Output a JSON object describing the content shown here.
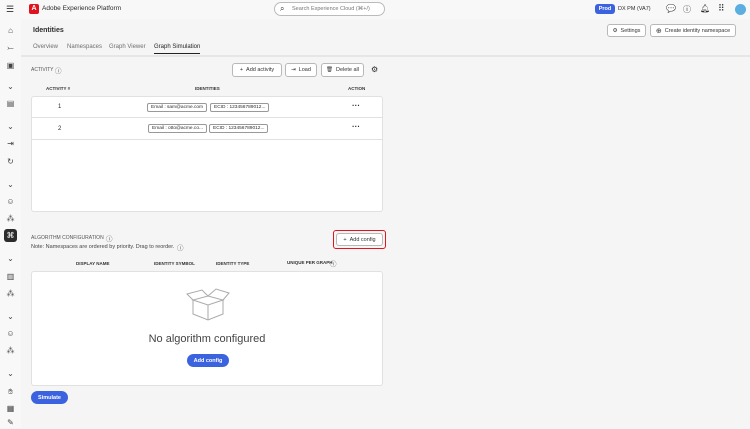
{
  "app": {
    "title": "Adobe Experience Platform",
    "search_placeholder": "Search Experience Cloud (⌘+/)",
    "env_badge": "Prod",
    "org": "DX PM (VA7)"
  },
  "page": {
    "title": "Identities",
    "settings": "Settings",
    "create": "Create identity namespace"
  },
  "tabs": [
    "Overview",
    "Namespaces",
    "Graph Viewer",
    "Graph Simulation"
  ],
  "activity": {
    "label": "ACTIVITY",
    "add": "Add activity",
    "load": "Load",
    "delete_all": "Delete all",
    "columns": [
      "ACTIVITY #",
      "IDENTITIES",
      "ACTION"
    ],
    "rows": [
      {
        "num": "1",
        "ids": [
          "Email : sam@acme.com",
          "ECID : 123456789012..."
        ]
      },
      {
        "num": "2",
        "ids": [
          "Email : otto@acme.co...",
          "ECID : 123456789012..."
        ]
      }
    ]
  },
  "algorithm": {
    "label": "ALGORITHM CONFIGURATION",
    "note": "Note: Namespaces are ordered by priority. Drag to reorder.",
    "add": "Add config",
    "columns": [
      "DISPLAY NAME",
      "IDENTITY SYMBOL",
      "IDENTITY TYPE",
      "UNIQUE PER GRAPH"
    ],
    "empty": "No algorithm configured",
    "empty_button": "Add config"
  },
  "simulate": "Simulate",
  "colors": {
    "accent": "#3b63e0",
    "highlight": "#e0141e"
  }
}
